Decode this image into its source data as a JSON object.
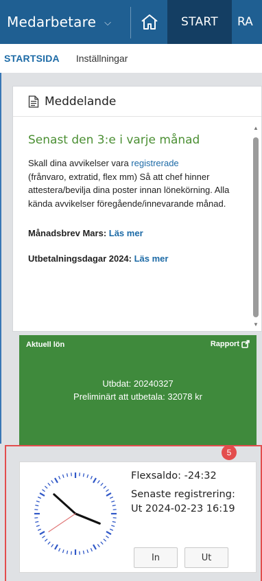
{
  "topbar": {
    "app_name": "Medarbetare",
    "start_label": "START",
    "more_label": "RA",
    "bg_color": "#1f5f92",
    "active_color": "#143e63",
    "icons": [
      "chevron-down-icon",
      "home-icon"
    ]
  },
  "subnav": {
    "active_label": "STARTSIDA",
    "settings_label": "Inställningar"
  },
  "message": {
    "title": "Meddelande",
    "headline": "Senast den 3:e i varje månad",
    "text_before_link": "Skall dina avvikelser vara ",
    "link_text": "registrerade",
    "text_after_link": "(frånvaro, extratid, flex mm) Så att chef hinner attestera/bevilja dina poster innan lönekörning. Alla kända avvikelser föregående/innevarande månad.",
    "letter_label": "Månadsbrev Mars: ",
    "letter_link": "Läs mer",
    "payday_label": "Utbetalningsdagar 2024: ",
    "payday_link": "Läs mer",
    "headline_color": "#4b8f33",
    "link_color": "#1c6aa6"
  },
  "salary": {
    "label": "Aktuell lön",
    "report_label": "Rapport",
    "paid": "Utbdat: 20240327",
    "preliminary": "Preliminärt att utbetala: 32078 kr",
    "bg_color": "#3f8a3c"
  },
  "flex": {
    "saldo": "Flexsaldo: -24:32",
    "last_label": "Senaste registrering:",
    "last_value": "Ut 2024-02-23 16:19",
    "badge_count": "5",
    "in_label": "In",
    "out_label": "Ut",
    "badge_color": "#e34d4d"
  }
}
